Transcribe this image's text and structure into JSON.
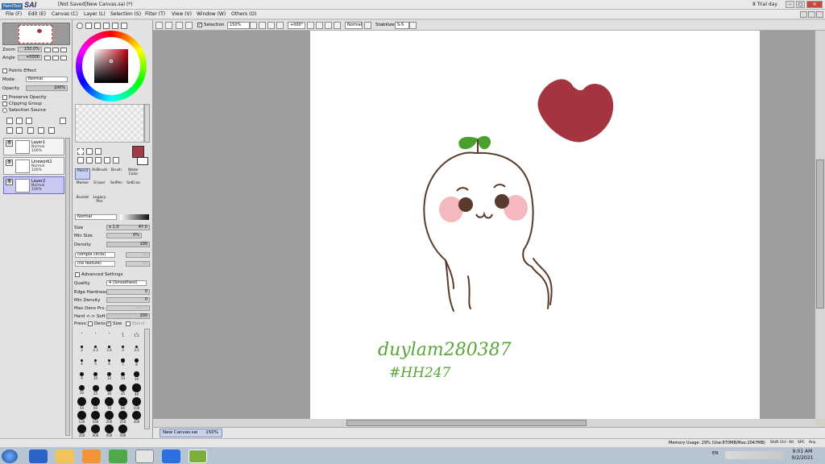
{
  "app": {
    "logo_small": "PaintTool",
    "logo_big": "SAI",
    "title": "[Not Saved]New Canvas.sai (*)",
    "trial": "8 Trial day"
  },
  "menu": [
    "File (F)",
    "Edit (E)",
    "Canvas (C)",
    "Layer (L)",
    "Selection (S)",
    "Filter (T)",
    "View (V)",
    "Window (W)",
    "Others (O)"
  ],
  "toolbar": {
    "selection_label": "Selection",
    "zoom": "150%",
    "angle": "+000°",
    "mode": "Normal",
    "stabilizer_label": "Stabilizer",
    "stabilizer_value": "S-5"
  },
  "navigator": {
    "zoom_label": "Zoom",
    "zoom_value": "150.0%",
    "angle_label": "Angle",
    "angle_value": "+0000"
  },
  "layer_props": {
    "paper_effect": "Paints Effect",
    "mode_label": "Mode",
    "mode_value": "Normal",
    "opacity_label": "Opacity",
    "opacity_value": "100%",
    "preserve_opacity": "Preserve Opacity",
    "clipping_group": "Clipping Group",
    "selection_source": "Selection Source"
  },
  "layers": [
    {
      "name": "Layer1",
      "mode": "Normal",
      "opacity": "100%",
      "selected": false
    },
    {
      "name": "Linework1",
      "mode": "Normal",
      "opacity": "100%",
      "selected": false
    },
    {
      "name": "Layer2",
      "mode": "Normal",
      "opacity": "100%",
      "selected": true
    }
  ],
  "tools": [
    {
      "name": "Pencil",
      "selected": true
    },
    {
      "name": "AirBrush"
    },
    {
      "name": "Brush"
    },
    {
      "name": "Water Color"
    },
    {
      "name": "Marker"
    },
    {
      "name": "Eraser"
    },
    {
      "name": "SelPen"
    },
    {
      "name": "SelEras"
    },
    {
      "name": "Bucket"
    },
    {
      "name": "Legacy Pen"
    }
  ],
  "brush": {
    "blend_mode": "Normal",
    "size_label": "Size",
    "size_mult": "x 1.0",
    "size_value": "47.0",
    "min_size_label": "Min Size",
    "min_size_value": "0%",
    "density_label": "Density",
    "density_value": "100",
    "shape": "(simple circle)",
    "shape_value": "50",
    "texture": "(no texture)",
    "texture_value": "95",
    "advanced": "Advanced Settings",
    "quality_label": "Quality",
    "quality_value": "4 (Smoothest)",
    "edge_label": "Edge Hardness",
    "edge_value": "0",
    "min_density_label": "Min Density",
    "min_density_value": "0",
    "max_dens_label": "Max Dens Prs.",
    "max_dens_value": "100 %",
    "hard_soft_label": "Hard <-> Soft",
    "hard_soft_value": "200",
    "press_label": "Press:",
    "press_dens": "Dens",
    "press_size": "Size",
    "press_blend": "Blend"
  },
  "brush_sizes": [
    "",
    "",
    "",
    "1",
    "1.5",
    "2",
    "2.3",
    "2.6",
    "3",
    "3.5",
    "4",
    "5",
    "6",
    "7",
    "8",
    "9",
    "10",
    "12",
    "14",
    "16",
    "20",
    "25",
    "30",
    "35",
    "40",
    "50",
    "60",
    "70",
    "80",
    "100",
    "120",
    "160",
    "200",
    "250",
    "300",
    "350",
    "400",
    "450",
    "500"
  ],
  "colors": {
    "primary": "#a13a44",
    "heart": "#a4343f",
    "cheek": "#f6b8bf",
    "outline": "#5a3a2c",
    "sprout": "#4aa02c",
    "signature": "#5aa53a"
  },
  "canvas": {
    "signature_line1": "duylam280387",
    "signature_line2": "#HH247"
  },
  "docbar": {
    "tab_name": "New Canvas.sai",
    "tab_zoom": "150%"
  },
  "status": {
    "memory": "Memory Usage: 29% (Use:870MB/Max:2047MB)",
    "keys": [
      "Shift",
      "Ctrl",
      "Alt",
      "SPC",
      "Any"
    ]
  },
  "taskbar": {
    "lang": "EN",
    "time": "9:01 AM",
    "date": "9/2/2021"
  }
}
